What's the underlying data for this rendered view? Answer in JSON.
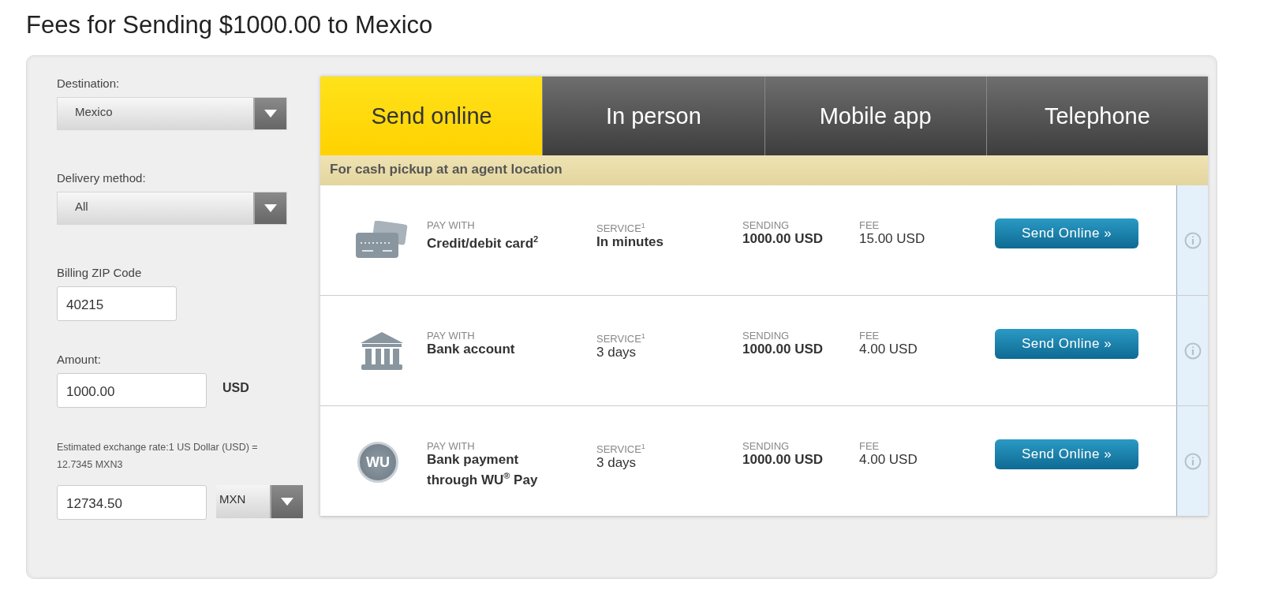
{
  "title": "Fees for Sending $1000.00 to Mexico",
  "form": {
    "destination": {
      "label": "Destination:",
      "value": "Mexico"
    },
    "delivery": {
      "label": "Delivery method:",
      "value": "All"
    },
    "zip": {
      "label": "Billing ZIP Code",
      "value": "40215"
    },
    "amount": {
      "label": "Amount:",
      "value": "1000.00",
      "currency": "USD"
    },
    "rate_note": "Estimated exchange rate:1 US Dollar (USD) = 12.7345 MXN3",
    "converted": {
      "value": "12734.50",
      "currency": "MXN"
    }
  },
  "tabs": [
    {
      "label": "Send online",
      "selected": true
    },
    {
      "label": "In person",
      "selected": false
    },
    {
      "label": "Mobile app",
      "selected": false
    },
    {
      "label": "Telephone",
      "selected": false
    }
  ],
  "banner": "For cash pickup at an agent location",
  "options": [
    {
      "kind": "card",
      "pay_label": "PAY WITH",
      "pay_value": "Credit/debit card$^{2}$",
      "service_label": "SERVICE$^{1}$",
      "service_value": "In minutes",
      "sending_label": "SENDING",
      "sending_value": "1000.00 USD",
      "fee_label": "FEE",
      "fee_value": "15.00 USD",
      "button": "Send Online »"
    },
    {
      "kind": "bank",
      "pay_label": "PAY WITH",
      "pay_value": "Bank account",
      "service_label": "SERVICE$^{1}$",
      "service_value": "3 days",
      "sending_label": "SENDING",
      "sending_value": "1000.00 USD",
      "fee_label": "FEE",
      "fee_value": "4.00 USD",
      "button": "Send Online »"
    },
    {
      "kind": "wu",
      "logo_text": "WU",
      "pay_label": "PAY WITH",
      "pay_value": "Bank payment through WU$^{®}$ Pay",
      "service_label": "SERVICE$^{1}$",
      "service_value": "3 days",
      "sending_label": "SENDING",
      "sending_value": "1000.00 USD",
      "fee_label": "FEE",
      "fee_value": "4.00 USD",
      "button": "Send Online »"
    }
  ]
}
